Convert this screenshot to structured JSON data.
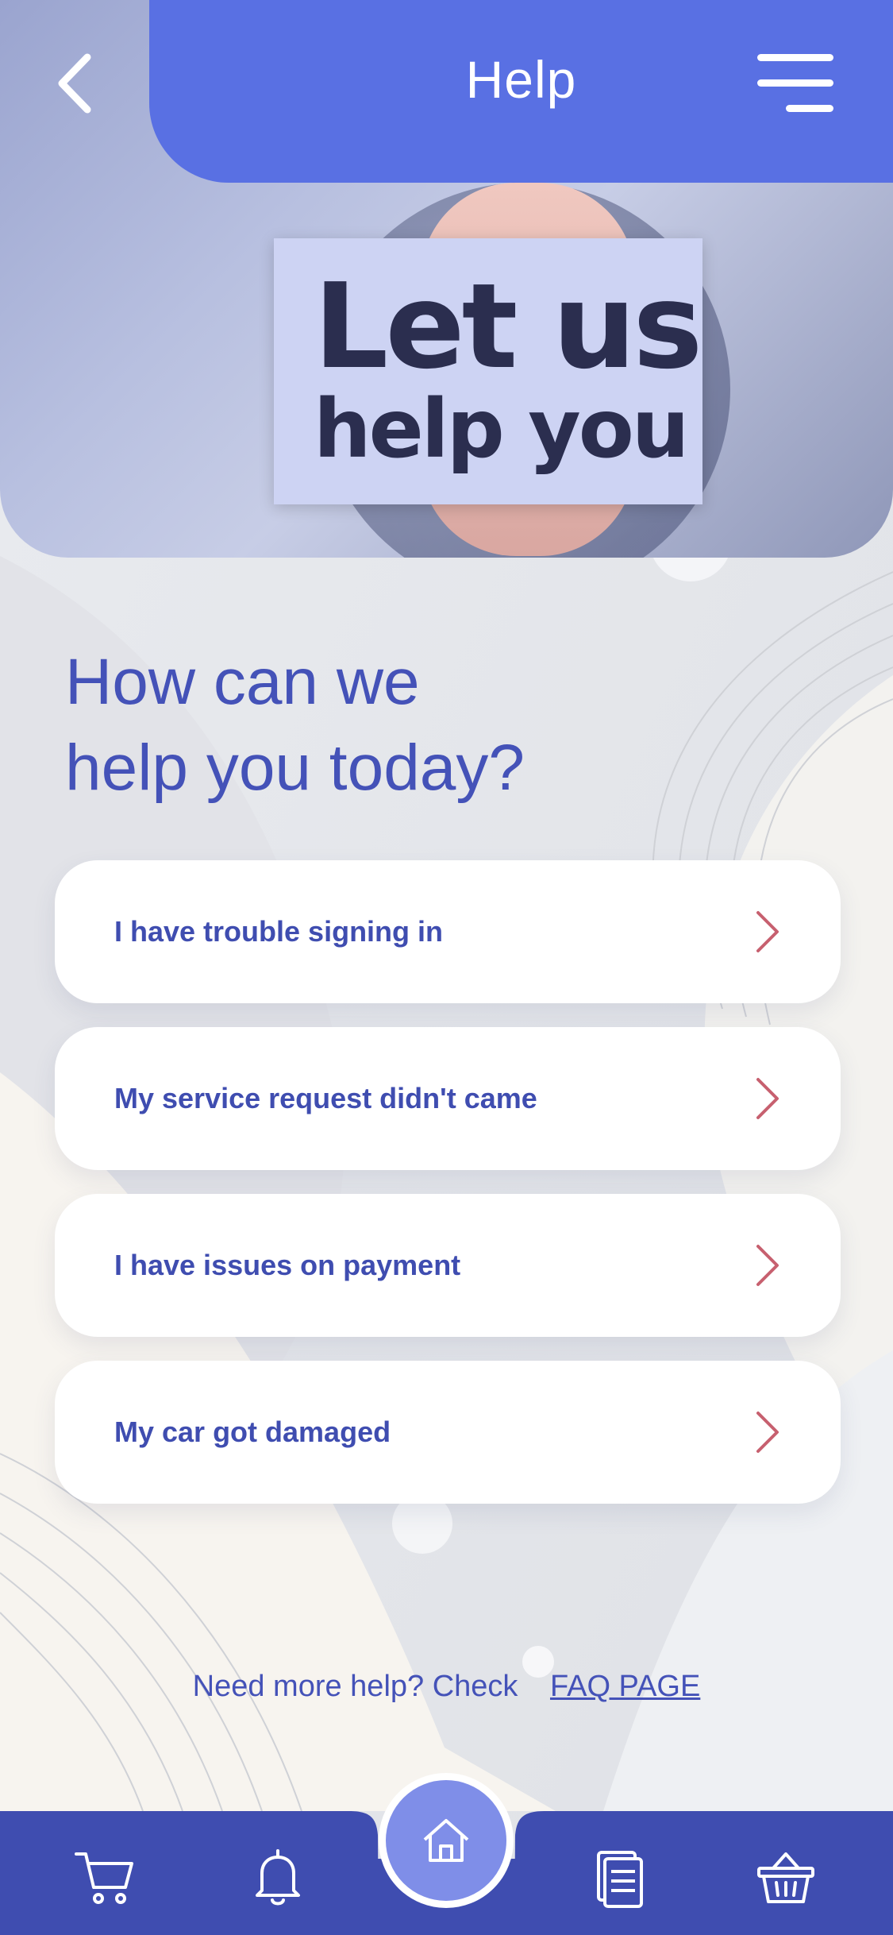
{
  "header": {
    "title": "Help",
    "back_icon": "chevron-left-icon",
    "menu_icon": "hamburger-menu-icon"
  },
  "hero": {
    "line1": "Let us",
    "line2": "help you"
  },
  "main": {
    "title_line1": "How can we",
    "title_line2": "help you today?"
  },
  "options": [
    {
      "label": "I have trouble signing in"
    },
    {
      "label": "My service request didn't came"
    },
    {
      "label": "I have issues on payment"
    },
    {
      "label": "My car got damaged"
    }
  ],
  "footer_note": {
    "text": "Need more help? Check",
    "link": "FAQ PAGE"
  },
  "bottom_nav": {
    "items": [
      "cart-icon",
      "bell-icon",
      "home-icon",
      "document-icon",
      "basket-icon"
    ]
  },
  "colors": {
    "primary": "#5970e3",
    "nav": "#3f4db0",
    "text": "#3f4db0",
    "chevron": "#c7606f"
  }
}
